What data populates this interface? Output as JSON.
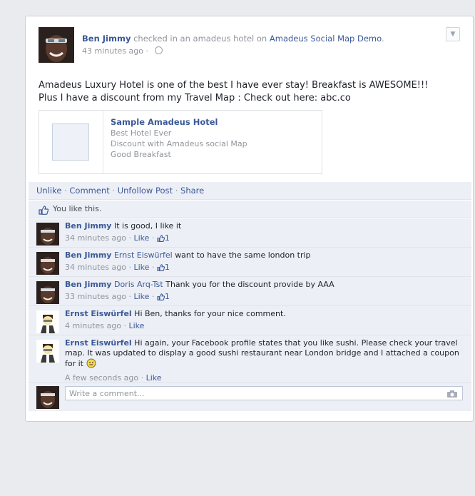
{
  "post": {
    "author": "Ben Jimmy",
    "action_text": "checked in an amadeus hotel on",
    "app_name": "Amadeus Social Map Demo",
    "time": "43 minutes ago",
    "time_separator": "·",
    "status_line1": "Amadeus Luxury Hotel is one of the best I have ever stay! Breakfast is AWESOME!!!",
    "status_line2": "Plus I have a discount from my Travel Map : Check out here: abc.co"
  },
  "attachment": {
    "title": "Sample Amadeus Hotel",
    "lines": [
      "Best Hotel Ever",
      "Discount with Amadeus social Map",
      "Good Breakfast"
    ]
  },
  "actions": {
    "unlike": "Unlike",
    "comment": "Comment",
    "unfollow": "Unfollow Post",
    "share": "Share",
    "separator": "·"
  },
  "likes": {
    "text": "You like this."
  },
  "comments": [
    {
      "author": "Ben Jimmy",
      "tag": "",
      "text": "It is good, I like it",
      "time": "34 minutes ago",
      "like": "Like",
      "count": "1"
    },
    {
      "author": "Ben Jimmy",
      "tag": "Ernst Eiswürfel",
      "text": "want to have the same london trip",
      "time": "34 minutes ago",
      "like": "Like",
      "count": "1"
    },
    {
      "author": "Ben Jimmy",
      "tag": "Doris Arq-Tst",
      "text": "Thank you for the discount provide by AAA",
      "time": "33 minutes ago",
      "like": "Like",
      "count": "1"
    },
    {
      "author": "Ernst Eiswürfel",
      "tag": "",
      "text": "Hi Ben, thanks for your nice comment.",
      "time": "4 minutes ago",
      "like": "Like",
      "count": ""
    },
    {
      "author": "Ernst Eiswürfel",
      "tag": "",
      "text": "Hi again, your Facebook profile states that you like sushi. Please check your travel map. It was updated to display a good sushi restaurant near London bridge and I attached a coupon for it",
      "time": "A few seconds ago",
      "like": "Like",
      "count": ""
    }
  ],
  "composer": {
    "placeholder": "Write a comment..."
  },
  "colors": {
    "link": "#3b5998",
    "meta": "#90949c",
    "panel": "#eceff5",
    "page_bg": "#e9ebee"
  }
}
